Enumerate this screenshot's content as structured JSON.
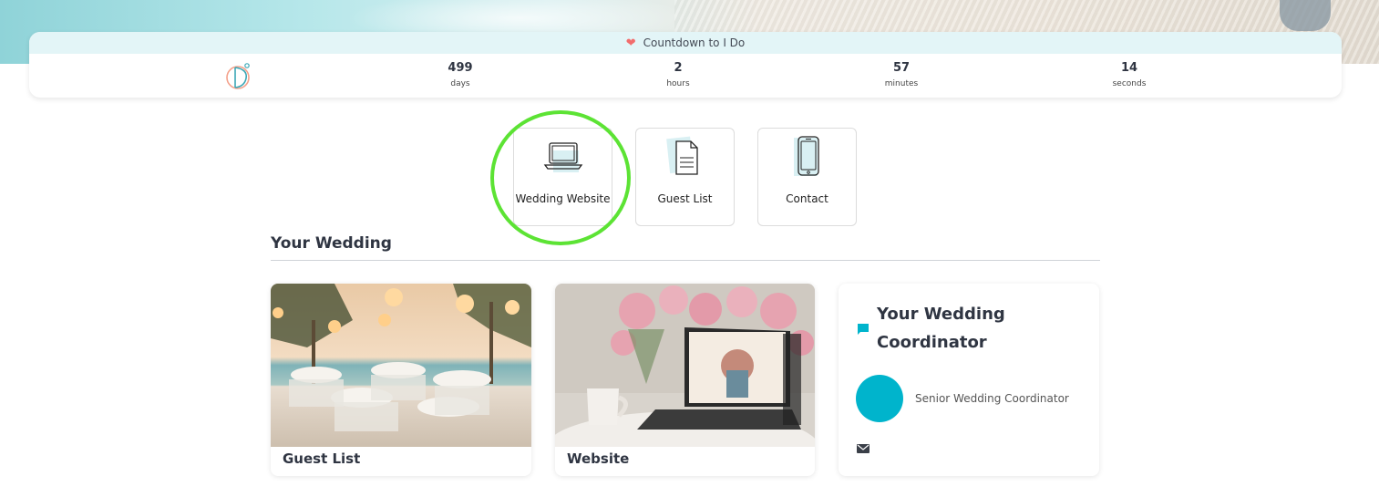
{
  "countdown": {
    "title": "Countdown to I Do",
    "days": {
      "value": "499",
      "label": "days"
    },
    "hours": {
      "value": "2",
      "label": "hours"
    },
    "minutes": {
      "value": "57",
      "label": "minutes"
    },
    "seconds": {
      "value": "14",
      "label": "seconds"
    }
  },
  "quick_links": {
    "website": {
      "label": "Wedding Website",
      "icon": "laptop-icon"
    },
    "guest_list": {
      "label": "Guest List",
      "icon": "document-icon"
    },
    "contact": {
      "label": "Contact",
      "icon": "phone-icon"
    }
  },
  "section": {
    "title": "Your Wedding"
  },
  "cards": {
    "guest_list": {
      "caption": "Guest List"
    },
    "website": {
      "caption": "Website"
    },
    "coordinator": {
      "title": "Your Wedding Coordinator",
      "role": "Senior Wedding Coordinator",
      "icons": [
        "chat-icon",
        "mail-icon"
      ]
    }
  },
  "colors": {
    "accent": "#00b4cc",
    "highlight": "#5ce334",
    "heart": "#f26d6d",
    "countdown_bar": "#e3f5f7"
  }
}
